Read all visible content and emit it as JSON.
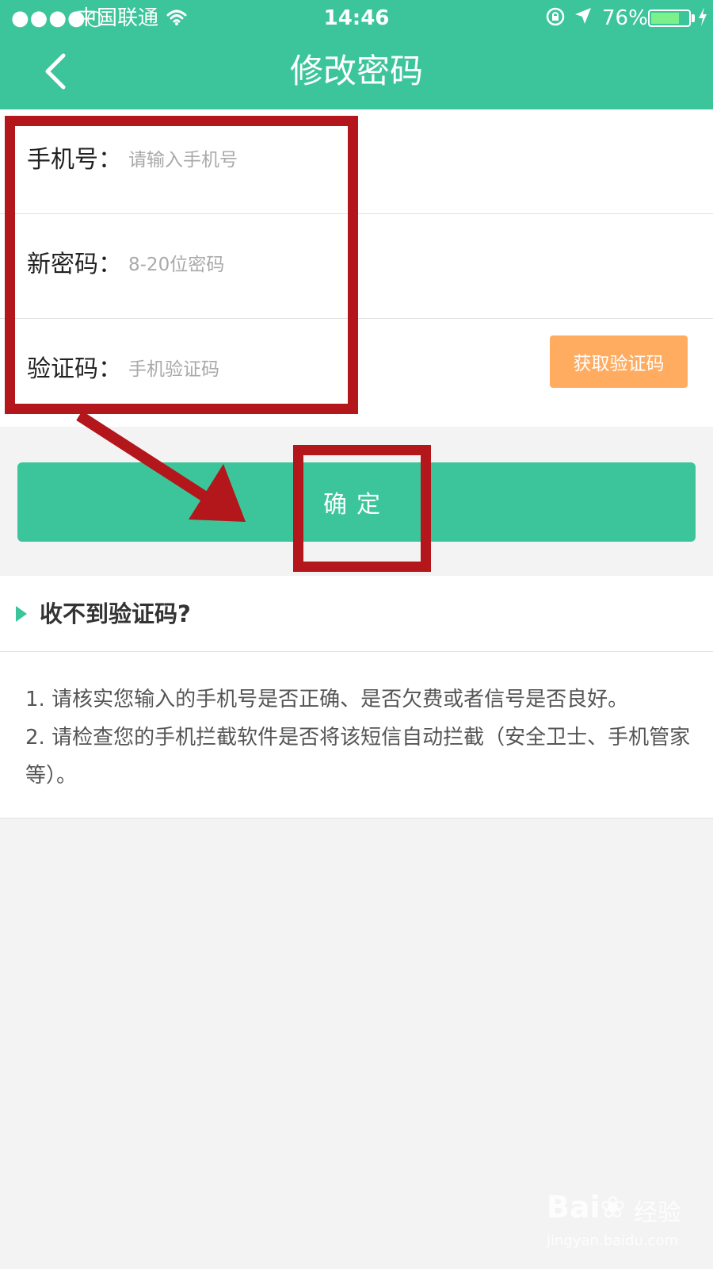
{
  "status_bar": {
    "signal": "●●●●○",
    "carrier": "中国联通",
    "time": "14:46",
    "battery_percent_text": "76%",
    "battery_level": 0.76,
    "battery_color": "#7cf08a"
  },
  "header": {
    "title": "修改密码",
    "background": "#3cc59a"
  },
  "form": {
    "phone": {
      "label": "手机号：",
      "placeholder": "请输入手机号",
      "value": ""
    },
    "password": {
      "label": "新密码：",
      "placeholder": "8-20位密码",
      "value": ""
    },
    "code": {
      "label": "验证码：",
      "placeholder": "手机验证码",
      "value": ""
    },
    "get_code_label": "获取验证码",
    "get_code_color": "#ffac60"
  },
  "confirm_label": "确定",
  "help": {
    "title": "收不到验证码?",
    "lines": [
      "1. 请核实您输入的手机号是否正确、是否欠费或者信号是否良好。",
      "2. 请检查您的手机拦截软件是否将该短信自动拦截（安全卫士、手机管家等）。"
    ]
  },
  "annotation_color": "#b3161b",
  "watermark": {
    "logo": "Bai❀",
    "text": "经验",
    "url": "jingyan.baidu.com"
  }
}
